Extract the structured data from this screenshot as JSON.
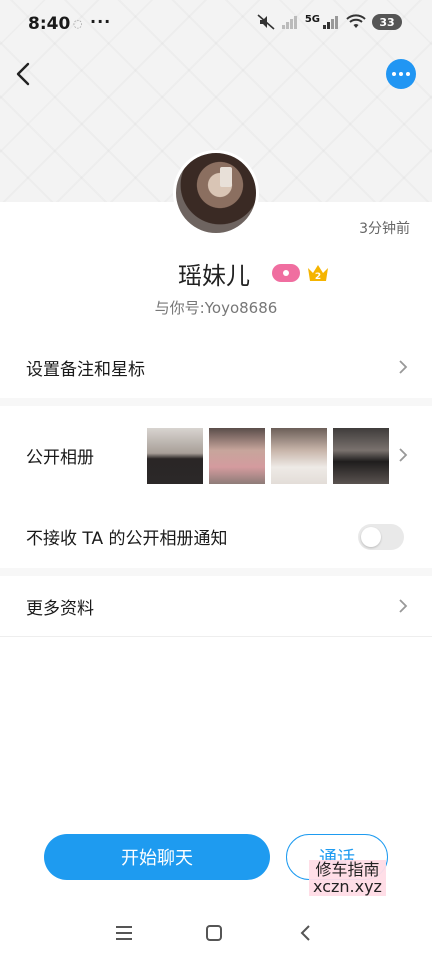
{
  "status_bar": {
    "time": "8:40",
    "dots": "···",
    "network_label": "5G",
    "battery": "33"
  },
  "profile": {
    "last_seen": "3分钟前",
    "name": "瑶妹儿",
    "crown_level": "2",
    "user_id": "与你号:Yoyo8686"
  },
  "menu": {
    "remark": "设置备注和星标",
    "album": "公开相册",
    "album_notify": "不接收 TA 的公开相册通知",
    "more_info": "更多资料"
  },
  "album_notify_enabled": false,
  "actions": {
    "chat": "开始聊天",
    "call": "通话"
  },
  "watermark": {
    "line1": "修车指南",
    "line2": "xczn.xyz"
  },
  "colors": {
    "accent": "#1e9bf0",
    "badge_pink": "#f06ea0",
    "crown": "#f5b400"
  },
  "icons": [
    "back-icon",
    "more-icon",
    "chevron-right-icon",
    "menu-icon",
    "home-icon",
    "nav-back-icon"
  ]
}
